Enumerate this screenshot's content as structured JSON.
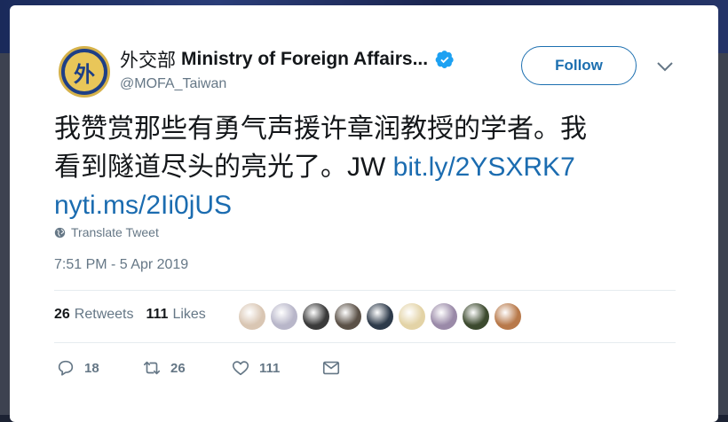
{
  "account": {
    "name_cn": "外交部",
    "name_en": "Ministry of Foreign Affairs...",
    "handle": "@MOFA_Taiwan",
    "avatar_glyph": "外",
    "verified": true
  },
  "follow_label": "Follow",
  "tweet": {
    "line1": "我赞赏那些有勇气声援许章润教授的学者。我",
    "line2_text": "看到隧道尽头的亮光了。JW ",
    "link1": "bit.ly/2YSXRK7",
    "link2": "nyti.ms/2Ii0jUS"
  },
  "translate_label": "Translate Tweet",
  "timestamp": "7:51 PM - 5 Apr 2019",
  "stats": {
    "retweets_count": "26",
    "retweets_label": "Retweets",
    "likes_count": "111",
    "likes_label": "Likes"
  },
  "actions": {
    "reply_count": "18",
    "retweet_count": "26",
    "like_count": "111"
  },
  "liker_avatars": [
    "#d9c6b3",
    "#b8b6c9",
    "#3a3a3a",
    "#5b5147",
    "#2d3a4a",
    "#e3d3a6",
    "#9a8aa8",
    "#3c4a2e",
    "#b8794a"
  ],
  "colors": {
    "accent": "#1b6cb0",
    "text": "#14171a",
    "muted": "#657786"
  }
}
